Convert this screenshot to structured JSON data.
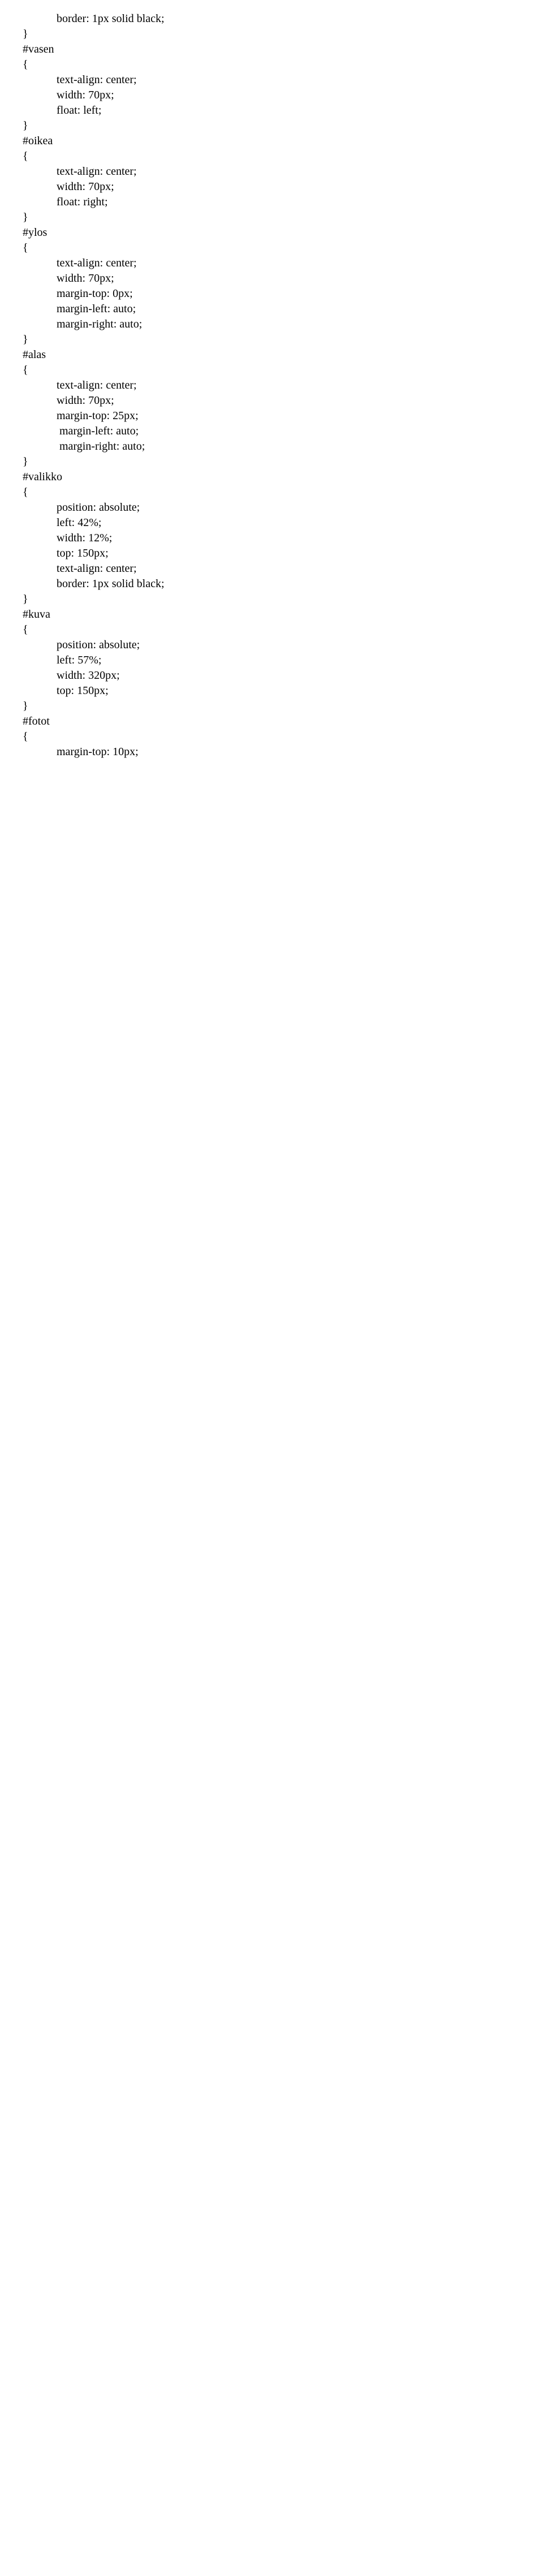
{
  "lines": [
    {
      "text": "border: 1px solid black;",
      "indent": true
    },
    {
      "text": "}",
      "indent": false
    },
    {
      "text": "#vasen",
      "indent": false
    },
    {
      "text": "{",
      "indent": false
    },
    {
      "text": "text-align: center;",
      "indent": true
    },
    {
      "text": "width: 70px;",
      "indent": true
    },
    {
      "text": "float: left;",
      "indent": true
    },
    {
      "text": "}",
      "indent": false
    },
    {
      "text": "#oikea",
      "indent": false
    },
    {
      "text": "{",
      "indent": false
    },
    {
      "text": "text-align: center;",
      "indent": true
    },
    {
      "text": "width: 70px;",
      "indent": true
    },
    {
      "text": "float: right;",
      "indent": true
    },
    {
      "text": "}",
      "indent": false
    },
    {
      "text": "#ylos",
      "indent": false
    },
    {
      "text": "{",
      "indent": false
    },
    {
      "text": "text-align: center;",
      "indent": true
    },
    {
      "text": "width: 70px;",
      "indent": true
    },
    {
      "text": "margin-top: 0px;",
      "indent": true
    },
    {
      "text": "margin-left: auto;",
      "indent": true
    },
    {
      "text": "margin-right: auto;",
      "indent": true
    },
    {
      "text": "}",
      "indent": false
    },
    {
      "text": "#alas",
      "indent": false
    },
    {
      "text": "{",
      "indent": false
    },
    {
      "text": "text-align: center;",
      "indent": true
    },
    {
      "text": "width: 70px;",
      "indent": true
    },
    {
      "text": "margin-top: 25px;",
      "indent": true
    },
    {
      "text": " margin-left: auto;",
      "indent": true
    },
    {
      "text": " margin-right: auto;",
      "indent": true
    },
    {
      "text": "}",
      "indent": false
    },
    {
      "text": "#valikko",
      "indent": false
    },
    {
      "text": "{",
      "indent": false
    },
    {
      "text": "position: absolute;",
      "indent": true
    },
    {
      "text": "left: 42%;",
      "indent": true
    },
    {
      "text": "width: 12%;",
      "indent": true
    },
    {
      "text": "top: 150px;",
      "indent": true
    },
    {
      "text": "text-align: center;",
      "indent": true
    },
    {
      "text": "border: 1px solid black;",
      "indent": true
    },
    {
      "text": "}",
      "indent": false
    },
    {
      "text": "#kuva",
      "indent": false
    },
    {
      "text": "{",
      "indent": false
    },
    {
      "text": "position: absolute;",
      "indent": true
    },
    {
      "text": "left: 57%;",
      "indent": true
    },
    {
      "text": "width: 320px;",
      "indent": true
    },
    {
      "text": "top: 150px;",
      "indent": true
    },
    {
      "text": "}",
      "indent": false
    },
    {
      "text": "#fotot",
      "indent": false
    },
    {
      "text": "{",
      "indent": false
    },
    {
      "text": "margin-top: 10px;",
      "indent": true
    }
  ]
}
